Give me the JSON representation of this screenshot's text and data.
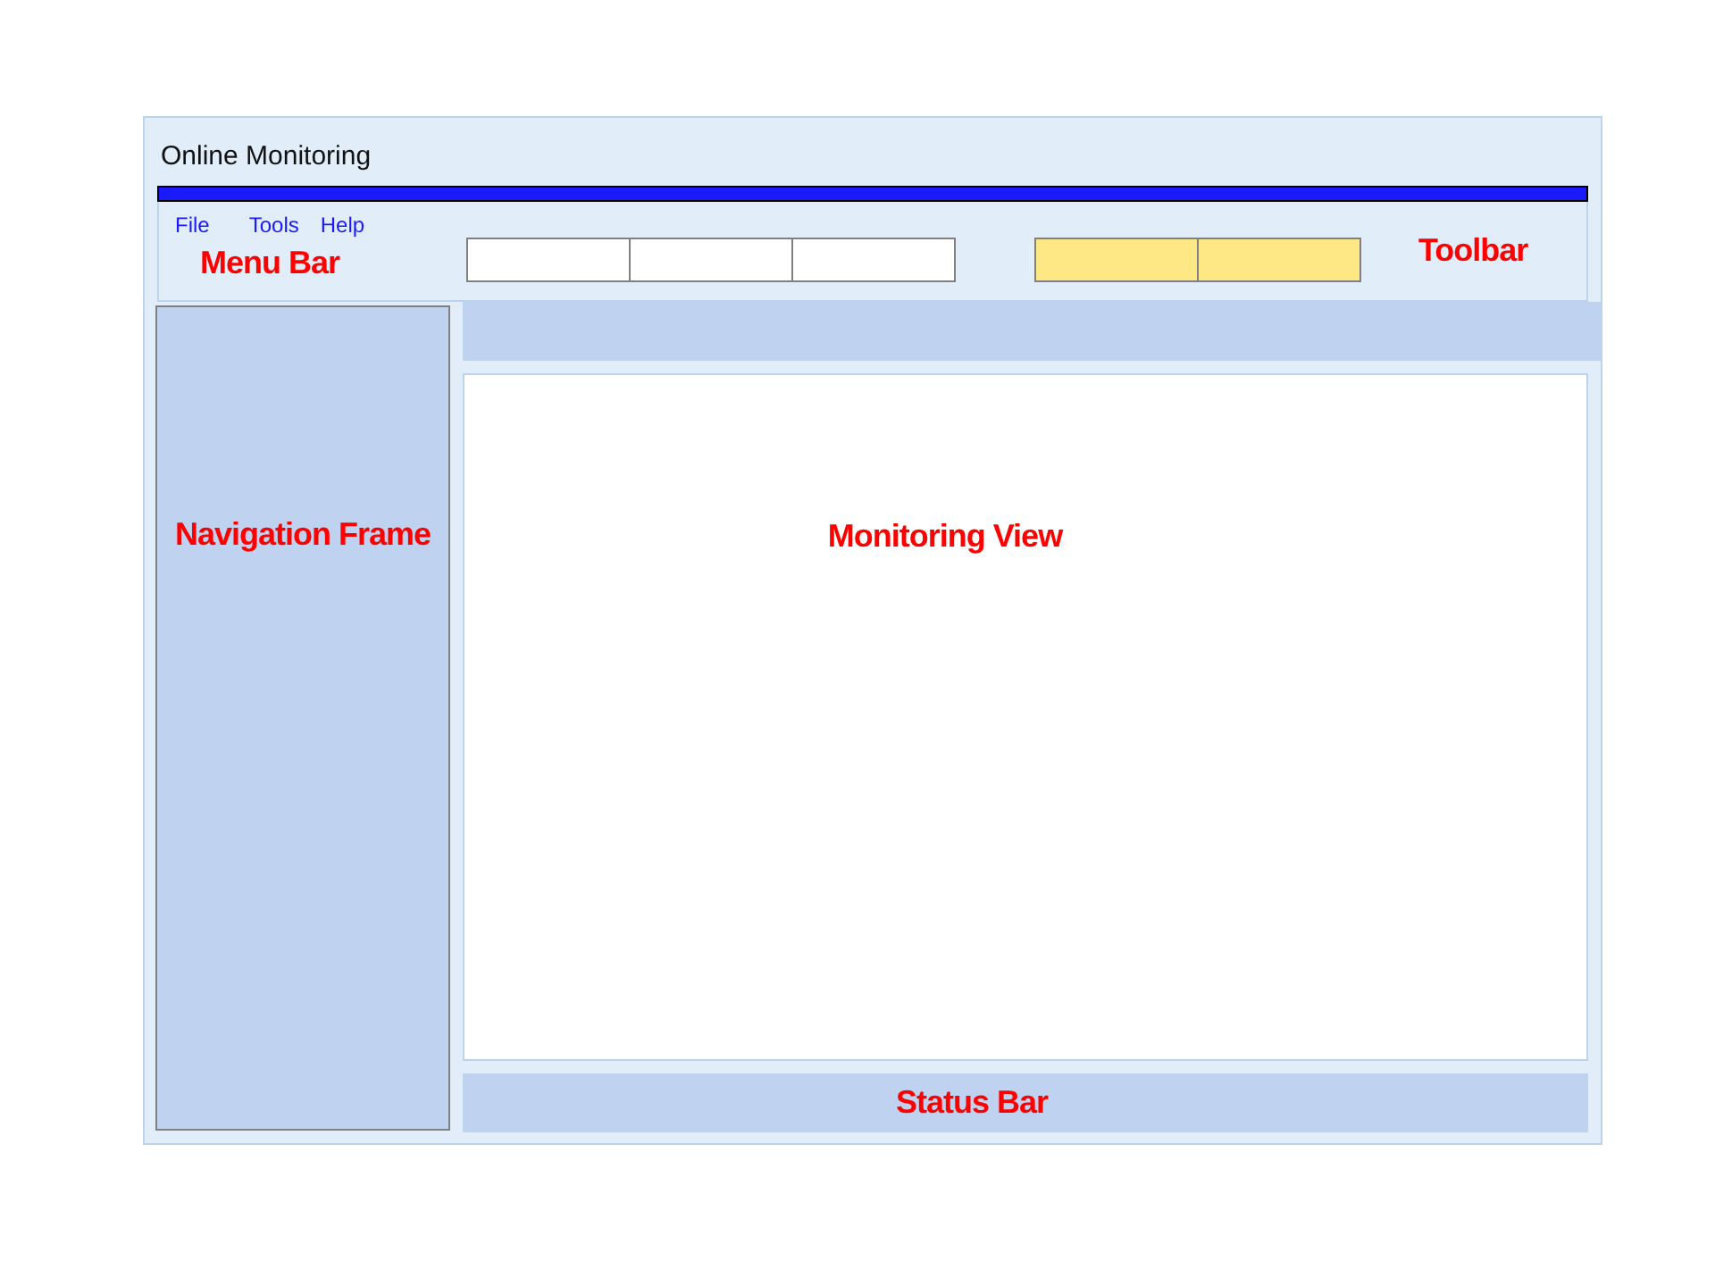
{
  "window": {
    "title": "Online Monitoring"
  },
  "menu": [
    "File",
    "Tools",
    "Help"
  ],
  "menu_label": "Menu Bar",
  "toolbar": {
    "slots": [
      {
        "kind": "field"
      },
      {
        "kind": "field"
      },
      {
        "kind": "field"
      },
      {
        "kind": "button"
      },
      {
        "kind": "button"
      }
    ],
    "label": "Toolbar"
  },
  "navigation": {
    "label": "Navigation Frame"
  },
  "view": {
    "label": "Monitoring View"
  },
  "status_bar": {
    "label": "Status Bar"
  }
}
